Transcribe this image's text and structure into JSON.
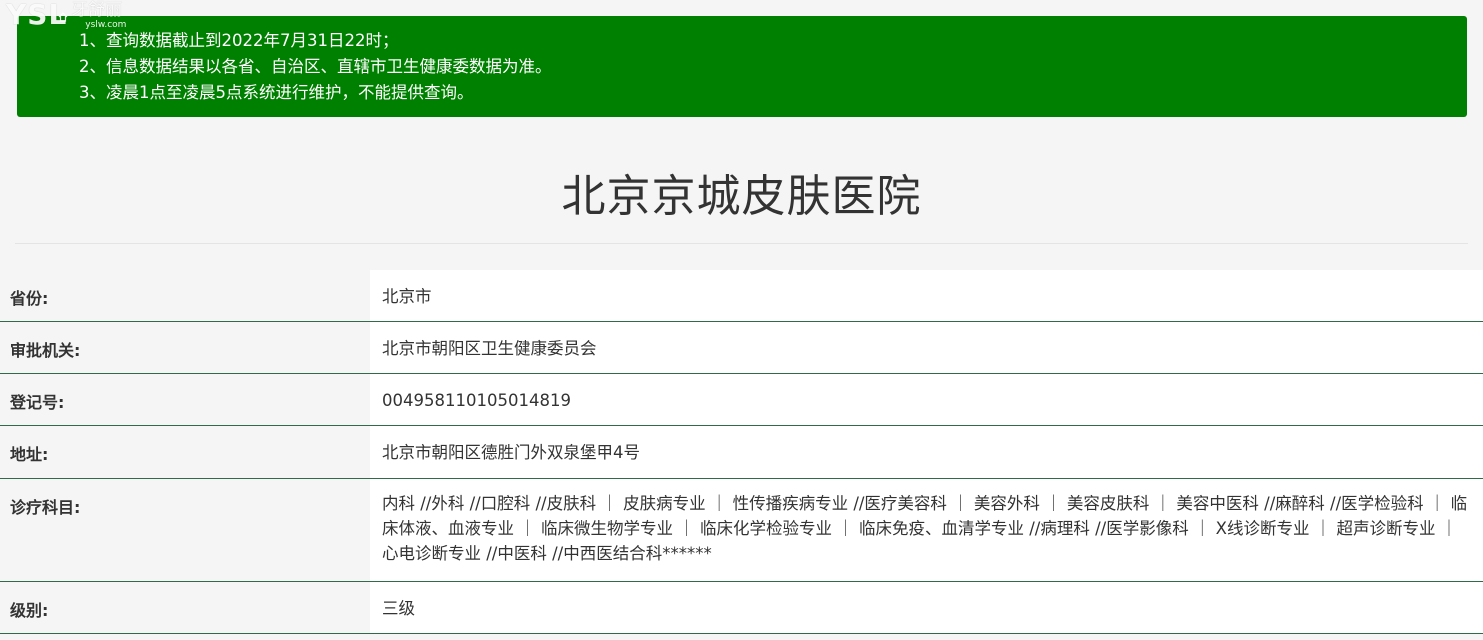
{
  "watermark": {
    "logo": "YSL",
    "brand_cn": "牙舒丽",
    "url": "yslw.com"
  },
  "notice": {
    "lines": [
      "1、查询数据截止到2022年7月31日22时；",
      "2、信息数据结果以各省、自治区、直辖市卫生健康委数据为准。",
      "3、凌晨1点至凌晨5点系统进行维护，不能提供查询。"
    ],
    "background": "#008000"
  },
  "hospital": {
    "name": "北京京城皮肤医院"
  },
  "rows": [
    {
      "label": "省份:",
      "value": "北京市"
    },
    {
      "label": "审批机关:",
      "value": "北京市朝阳区卫生健康委员会"
    },
    {
      "label": "登记号:",
      "value": "004958110105014819"
    },
    {
      "label": "地址:",
      "value": "北京市朝阳区德胜门外双泉堡甲4号"
    },
    {
      "label": "诊疗科目:",
      "value": "内科 //外科 //口腔科 //皮肤科 ｜ 皮肤病专业 ｜ 性传播疾病专业 //医疗美容科 ｜ 美容外科 ｜ 美容皮肤科 ｜ 美容中医科 //麻醉科 //医学检验科 ｜ 临床体液、血液专业 ｜ 临床微生物学专业 ｜ 临床化学检验专业 ｜ 临床免疫、血清学专业 //病理科 //医学影像科 ｜ X线诊断专业 ｜ 超声诊断专业 ｜ 心电诊断专业 //中医科 //中西医结合科******"
    },
    {
      "label": "级别:",
      "value": "三级"
    }
  ],
  "colors": {
    "row_border": "#2e6b4a",
    "page_bg": "#f5f5f5",
    "value_bg": "#ffffff"
  }
}
